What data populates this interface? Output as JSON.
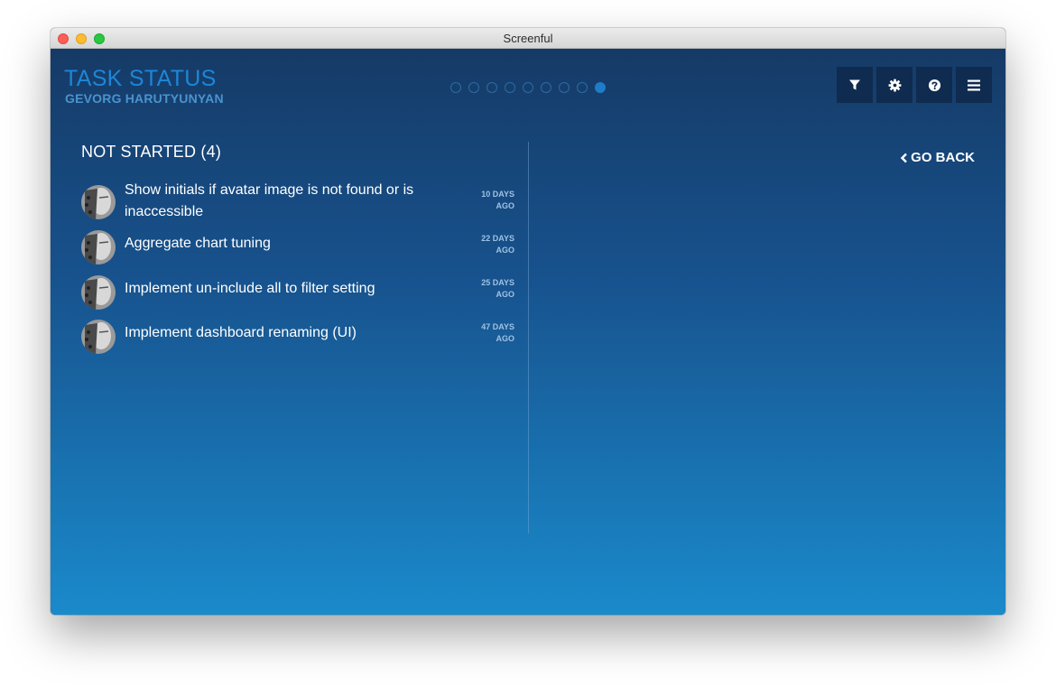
{
  "window": {
    "title": "Screenful"
  },
  "header": {
    "title": "TASK STATUS",
    "subtitle": "GEVORG HARUTYUNYAN",
    "pager": {
      "total": 9,
      "active": 9
    }
  },
  "toolbar": {
    "buttons": [
      {
        "name": "filter-button",
        "icon": "filter-icon"
      },
      {
        "name": "settings-button",
        "icon": "gear-icon"
      },
      {
        "name": "help-button",
        "icon": "help-icon"
      },
      {
        "name": "menu-button",
        "icon": "hamburger-menu-icon"
      }
    ]
  },
  "section": {
    "title": "NOT STARTED (4)"
  },
  "navigation": {
    "go_back_label": "GO BACK"
  },
  "tasks": [
    {
      "title": "Show initials if avatar image is not found or is inaccessible",
      "age_line1": "10 DAYS",
      "age_line2": "AGO"
    },
    {
      "title": "Aggregate chart tuning",
      "age_line1": "22 DAYS",
      "age_line2": "AGO"
    },
    {
      "title": "Implement un-include all to filter setting",
      "age_line1": "25 DAYS",
      "age_line2": "AGO"
    },
    {
      "title": "Implement dashboard renaming (UI)",
      "age_line1": "47 DAYS",
      "age_line2": "AGO"
    }
  ],
  "colors": {
    "title_accent": "#1d86d6",
    "button_bg": "#0f2b4f",
    "gradient_top": "#163a66",
    "gradient_bottom": "#1a8acb"
  }
}
